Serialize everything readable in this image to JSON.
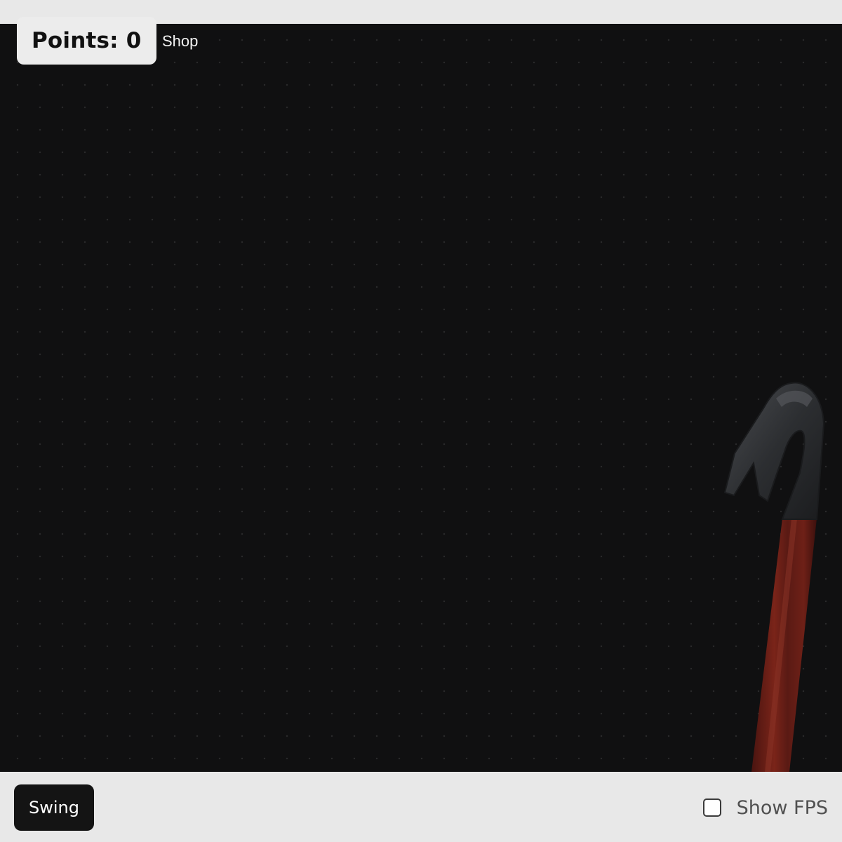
{
  "hud": {
    "points_label": "Points: 0",
    "shop_label": "Shop"
  },
  "scene": {
    "object": "crowbar",
    "handle_color": "#6b1e18",
    "hook_color": "#2c2e31"
  },
  "controls": {
    "swing_label": "Swing",
    "show_fps_label": "Show FPS",
    "show_fps_checked": false
  }
}
